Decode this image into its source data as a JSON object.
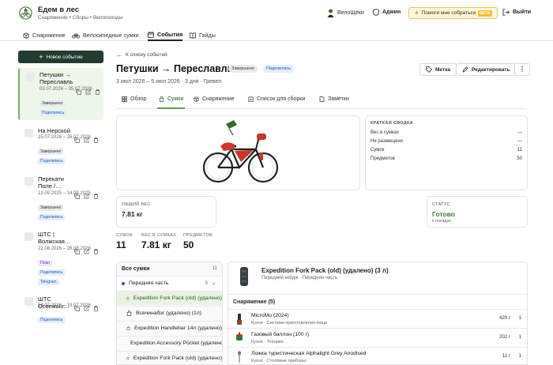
{
  "brand": {
    "title": "Едем в лес",
    "subtitle": "Снаряжение • Сборы • Велопоходы"
  },
  "user": {
    "name": "ВелоЩёки",
    "admin_label": "Админ",
    "help_label": "Помоги мне собраться",
    "beta_label": "BETA",
    "logout_label": "Выйти"
  },
  "nav": [
    {
      "label": "Снаряжение",
      "icon": "box-icon"
    },
    {
      "label": "Велосипедные сумки",
      "icon": "bike-icon"
    },
    {
      "label": "События",
      "icon": "calendar-icon",
      "active": true
    },
    {
      "label": "Гайды",
      "icon": "book-icon"
    }
  ],
  "sidebar": {
    "new_event_label": "Новое событие",
    "events": [
      {
        "title": "Петушки → Переславль",
        "dates": "03.07.2026 – 05.07.2026",
        "tags": [
          "Завершено",
          "Поделились"
        ]
      },
      {
        "title": "На Нерской",
        "dates": "25.07.2026 – 26.07.2026",
        "tags": [
          "Завершено",
          "Поделились"
        ]
      },
      {
        "title": "Перекати Поле /…",
        "dates": "13.09.2025 – 14.09.2025",
        "tags": [
          "Завершено",
          "Поделились"
        ]
      },
      {
        "title": "ШТС | Волжская…",
        "dates": "22.08.2026 – 26.08.2026",
        "tags": [
          "План",
          "Поделились",
          "Telegram"
        ]
      },
      {
        "title": "ШТС Освежаю…",
        "dates": "18.07.2026 – 19.07.2026",
        "tags": [
          "Поделились"
        ]
      }
    ]
  },
  "event": {
    "back_label": "К списку событий",
    "title": "Петушки → Переславль",
    "status_badge": "Завершено",
    "shared_badge": "Поделились",
    "subtitle": "3 июл 2026 – 5 июл 2026 · 3 дня · Гревел",
    "tag_button": "Метка",
    "edit_button": "Редактировать",
    "tabs": [
      {
        "label": "Обзор"
      },
      {
        "label": "Сумки",
        "active": true
      },
      {
        "label": "Снаряжение"
      },
      {
        "label": "Список для сборки"
      },
      {
        "label": "Заметки"
      }
    ]
  },
  "summary": {
    "title": "КРАТКАЯ СВОДКА",
    "rows": [
      {
        "label": "Вес в сумках",
        "value": "—"
      },
      {
        "label": "Не размещено",
        "value": "—"
      },
      {
        "label": "Сумок",
        "value": "11"
      },
      {
        "label": "Предметов",
        "value": "50"
      }
    ]
  },
  "total_weight": {
    "label": "ОБЩИЙ ВЕС",
    "value": "7.81 кг"
  },
  "status_card": {
    "label": "СТАТУС",
    "value": "Готово",
    "sub": "к поездке"
  },
  "stats": [
    {
      "label": "СУМОК",
      "value": "11"
    },
    {
      "label": "ВЕС В СУМКАХ",
      "value": "7.81 кг"
    },
    {
      "label": "ПРЕДМЕТОВ",
      "value": "50"
    }
  ],
  "bags": {
    "header": "Все сумки",
    "count": "11",
    "group": {
      "label": "Передняя часть",
      "count": "5"
    },
    "items": [
      "Expedition Fork Pack (old) (удалено)",
      "Всячинабэг (удалено) (1л)",
      "Expedition Handlebar 14л (удалено)",
      "Expedition Accessory Pocket (удалено)",
      "Expedition Fork Pack (old) (удалено)"
    ]
  },
  "bag_detail": {
    "title": "Expedition Fork Pack (old) (удалено) (3 л)",
    "subtitle": "Передний кейдж · Передняя часть",
    "gear_header": "Снаряжение (5)",
    "gear": [
      {
        "name": "MicroMo (2024)",
        "category": "Кухня · Система приготовления пищи",
        "weight": "429 г",
        "qty": "1"
      },
      {
        "name": "Газовый баллон (100 г)",
        "category": "Кухня · Топливо",
        "weight": "202 г",
        "qty": "1"
      },
      {
        "name": "Ложка туристическая Alphalight Grey Anodised",
        "category": "Кухня · Столовые приборы",
        "weight": "11 г",
        "qty": "1"
      }
    ]
  }
}
